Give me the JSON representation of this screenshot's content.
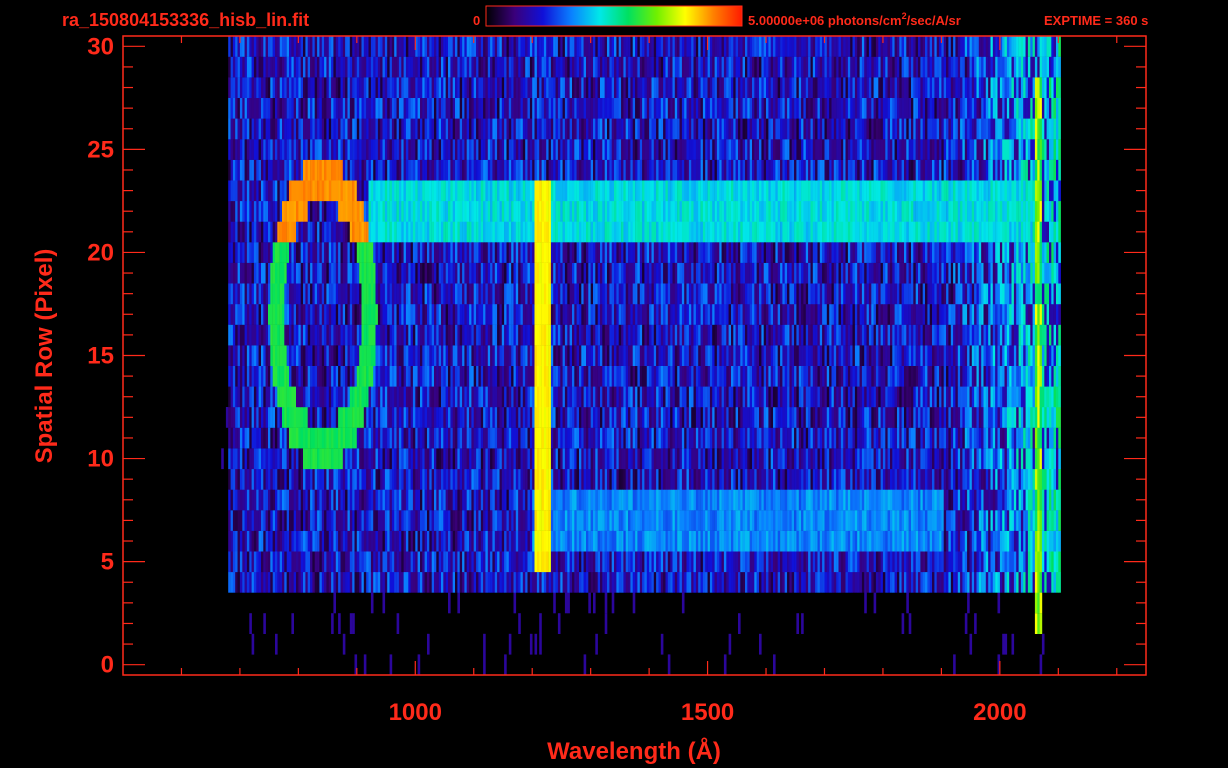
{
  "header": {
    "filename": "ra_150804153336_hisb_lin.fit",
    "colorbar_min_label": "0",
    "colorbar_max_label": "5.00000e+06 photons/cm",
    "colorbar_unit_exponent": "2",
    "colorbar_unit_rest": "/sec/A/sr",
    "exptime": "EXPTIME = 360 s"
  },
  "colors": {
    "text": "#ff2a1a",
    "frame": "#ff2a1a",
    "background": "#000000",
    "colormap": [
      "#000000",
      "#3a007a",
      "#1010d8",
      "#0a80ff",
      "#00e8e8",
      "#00e060",
      "#70f000",
      "#ffff00",
      "#ff8000",
      "#ff1a00"
    ]
  },
  "chart_data": {
    "type": "heatmap",
    "title": "ra_150804153336_hisb_lin.fit",
    "xlabel": "Wavelength (Å)",
    "ylabel": "Spatial Row (Pixel)",
    "xlim": [
      500,
      2250
    ],
    "ylim": [
      -0.5,
      30.5
    ],
    "x_ticks": [
      1000,
      1500,
      2000
    ],
    "y_ticks": [
      0,
      5,
      10,
      15,
      20,
      25,
      30
    ],
    "colorbar": {
      "min": 0,
      "max": 5000000,
      "unit": "photons/cm^2/sec/A/sr"
    },
    "exptime_s": 360,
    "rows": {
      "first": 0,
      "last": 30
    },
    "features": [
      {
        "name": "Lyman-alpha line",
        "wavelength": 1216,
        "rows": [
          5,
          23
        ],
        "level": 0.82
      },
      {
        "name": "upper band",
        "wavelength_range": [
          920,
          2060
        ],
        "rows": [
          21,
          23
        ],
        "level": 0.48
      },
      {
        "name": "lower band",
        "wavelength_range": [
          1200,
          1900
        ],
        "rows": [
          6,
          8
        ],
        "level": 0.38
      },
      {
        "name": "ring",
        "wavelength_center": 840,
        "row_center": 17,
        "radius_wavelength": 80,
        "radius_rows": 6.5,
        "level": 0.55
      },
      {
        "name": "red edge",
        "wavelength": 2065,
        "rows": [
          2,
          28
        ],
        "level": 0.75
      }
    ],
    "grid": false
  }
}
